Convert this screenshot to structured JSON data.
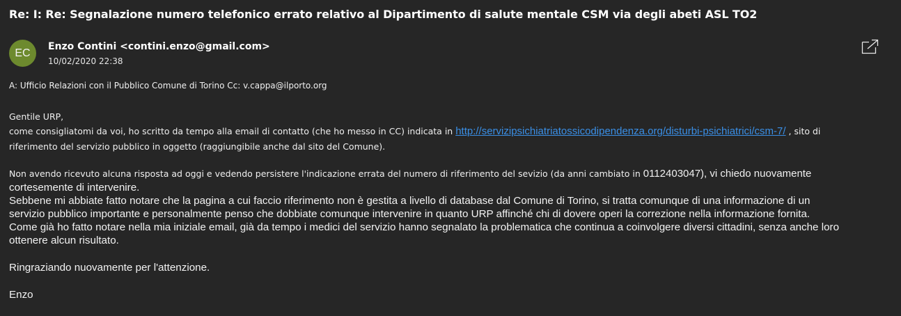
{
  "email": {
    "subject": "Re: I: Re: Segnalazione numero telefonico errato relativo al Dipartimento di salute mentale CSM via degli abeti ASL TO2",
    "avatar_initials": "EC",
    "avatar_color": "#6d8a2e",
    "sender": "Enzo Contini <contini.enzo@gmail.com>",
    "date": "10/02/2020 22:38",
    "recipients": "A: Ufficio Relazioni con il Pubblico Comune di Torino   Cc:  v.cappa@ilporto.org",
    "popout_icon": "open-in-new-window-icon"
  },
  "body": {
    "greeting": "Gentile URP,",
    "line1_before_link": "come consigliatomi da voi, ho scritto da tempo alla email di contatto (che ho messo in CC) indicata in ",
    "link": "http://servizipsichiatriatossicodipendenza.org/disturbi-psichiatrici/csm-7/",
    "line1_after_link": " , sito di",
    "line2": "riferimento del servizio pubblico in oggetto (raggiungibile anche dal sito del Comune).",
    "para2_line1_a": "Non avendo ricevuto alcuna risposta ad oggi e vedendo persistere l'indicazione errata del numero di riferimento del sevizio (da anni cambiato in ",
    "para2_line1_b": "0112403047), vi chiedo nuovamente",
    "para2_line2": "cortesemente di intervenire.",
    "para2_line3": "Sebbene mi abbiate fatto notare che la pagina a cui faccio riferimento non è gestita a livello di database dal Comune di Torino, si tratta comunque di una informazione di un",
    "para2_line4": "servizio pubblico importante e personalmente penso che dobbiate comunque intervenire in quanto URP affinché chi di dovere operi la correzione nella informazione fornita.",
    "para2_line5": "Come già ho fatto notare nella mia iniziale email, già da tempo i medici del servizio hanno segnalato la problematica che continua a  coinvolgere diversi cittadini, senza anche loro",
    "para2_line6": "ottenere alcun risultato.",
    "closing": "Ringraziando nuovamente per l'attenzione.",
    "signature": "Enzo"
  },
  "colors": {
    "background": "#262626",
    "text": "#ffffff",
    "link": "#3a8fe6"
  }
}
